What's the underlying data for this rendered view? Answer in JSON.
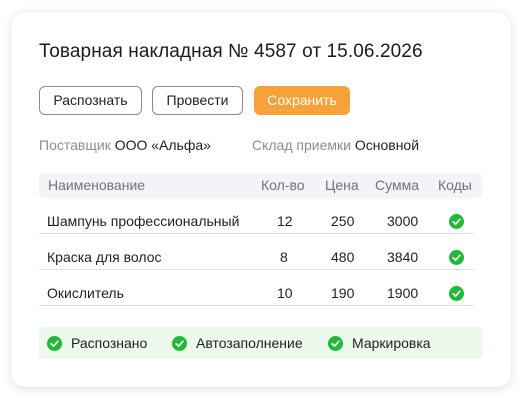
{
  "document": {
    "title": "Товарная накладная № 4587 от 15.06.2026"
  },
  "toolbar": {
    "recognize_label": "Распознать",
    "post_label": "Провести",
    "save_label": "Сохранить"
  },
  "meta": {
    "supplier_label": "Поставщик",
    "supplier_value": "ООО «Альфа»",
    "warehouse_label": "Склад приемки",
    "warehouse_value": "Основной"
  },
  "table": {
    "columns": [
      "Наименование",
      "Кол-во",
      "Цена",
      "Сумма",
      "Коды"
    ],
    "rows": [
      {
        "name": "Шампунь профессиональный",
        "qty": "12",
        "price": "250",
        "sum": "3000",
        "codes_ok": true
      },
      {
        "name": "Краска для волос",
        "qty": "8",
        "price": "480",
        "sum": "3840",
        "codes_ok": true
      },
      {
        "name": "Окислитель",
        "qty": "10",
        "price": "190",
        "sum": "1900",
        "codes_ok": true
      }
    ]
  },
  "status": {
    "items": [
      "Распознано",
      "Автозаполнение",
      "Маркировка"
    ]
  },
  "colors": {
    "accent": "#f6a23a",
    "success": "#22b83a",
    "success_bg": "#ecf9ec",
    "header_bg": "#f3f4f7",
    "muted_text": "#8a8d99"
  },
  "icons": {
    "check": "check-circle-icon"
  }
}
